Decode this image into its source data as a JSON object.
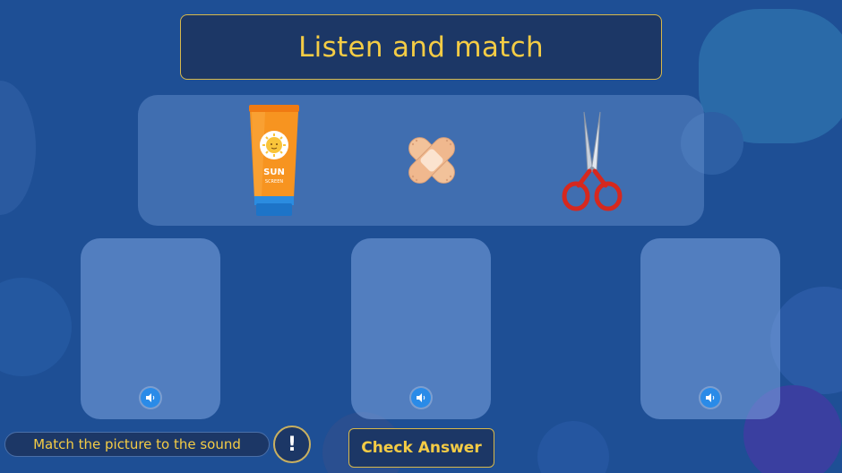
{
  "header": {
    "title": "Listen and match"
  },
  "items": [
    {
      "name": "sunscreen",
      "label_line1": "SUN",
      "label_line2": "SCREEN"
    },
    {
      "name": "bandage"
    },
    {
      "name": "scissors"
    }
  ],
  "drop_zones": [
    {
      "icon": "speaker-icon"
    },
    {
      "icon": "speaker-icon"
    },
    {
      "icon": "speaker-icon"
    }
  ],
  "footer": {
    "instruction": "Match the picture to the sound",
    "hint_symbol": "!",
    "check_label": "Check Answer"
  },
  "colors": {
    "background": "#1e4f95",
    "panel": "#1c3766",
    "accent_gold": "#f4cc45",
    "sound_button": "#2a8be8"
  }
}
